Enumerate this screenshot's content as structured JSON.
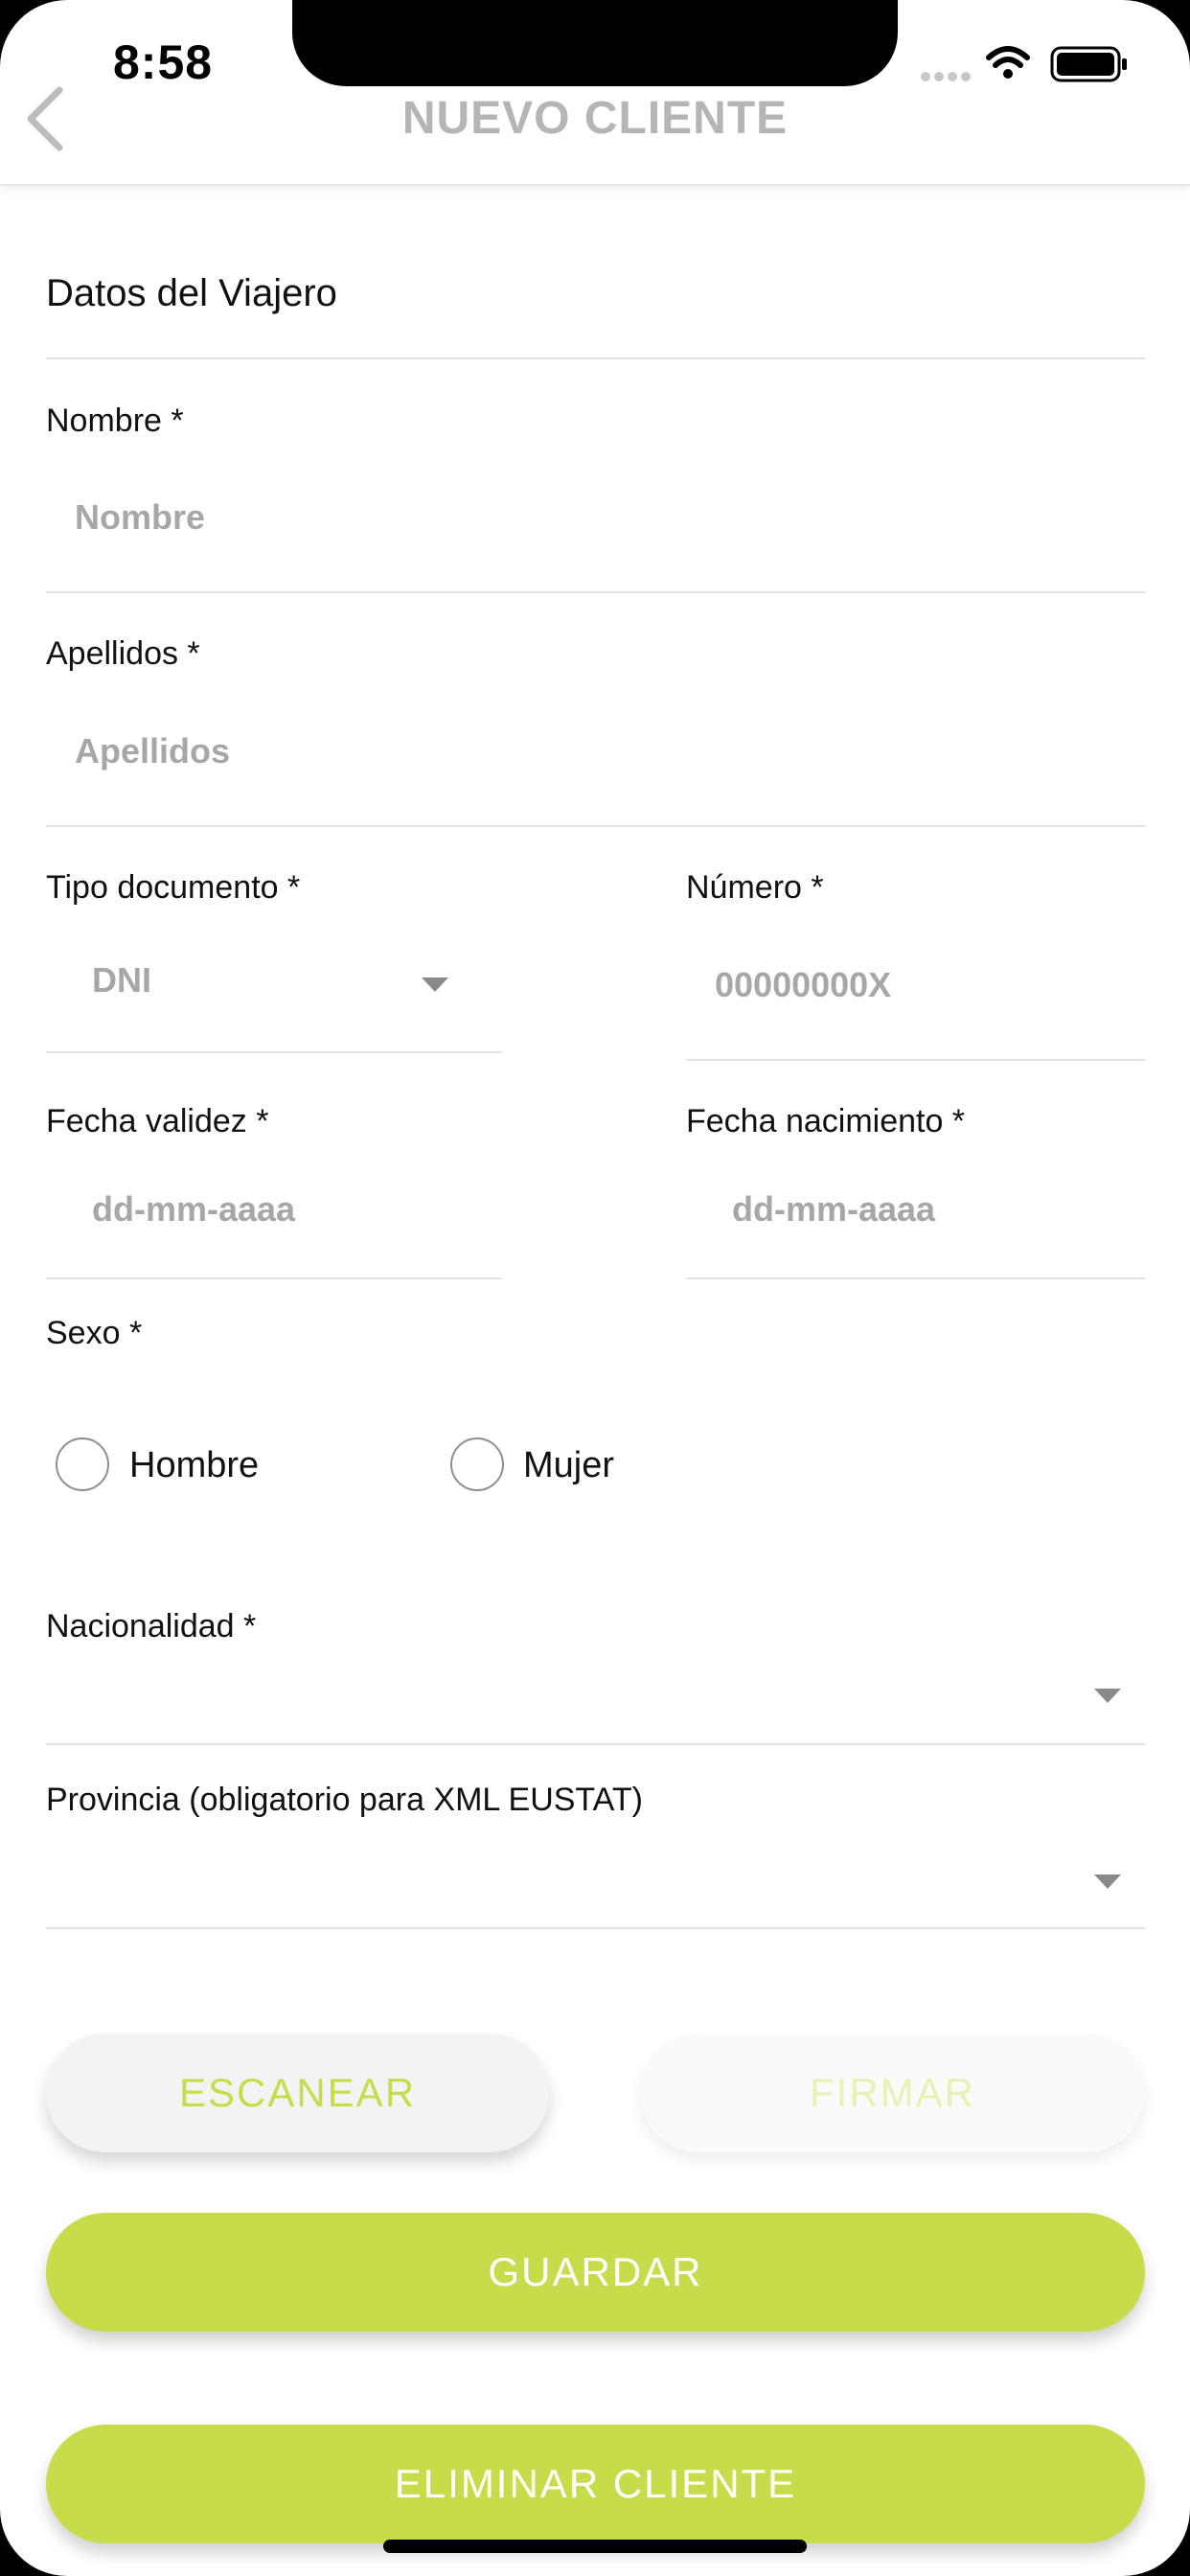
{
  "status_bar": {
    "time": "8:58"
  },
  "header": {
    "title": "NUEVO CLIENTE",
    "back_icon": "chevron-left-icon"
  },
  "form": {
    "section_title": "Datos del Viajero",
    "nombre": {
      "label": "Nombre *",
      "placeholder": "Nombre",
      "value": ""
    },
    "apellidos": {
      "label": "Apellidos *",
      "placeholder": "Apellidos",
      "value": ""
    },
    "tipo_documento": {
      "label": "Tipo documento *",
      "selected": "DNI"
    },
    "numero": {
      "label": "Número *",
      "placeholder": "00000000X",
      "value": ""
    },
    "fecha_validez": {
      "label": "Fecha validez *",
      "placeholder": "dd-mm-aaaa"
    },
    "fecha_nacimiento": {
      "label": "Fecha nacimiento *",
      "placeholder": "dd-mm-aaaa"
    },
    "sexo": {
      "label": "Sexo *",
      "options": [
        "Hombre",
        "Mujer"
      ],
      "selected": null
    },
    "nacionalidad": {
      "label": "Nacionalidad *",
      "selected": ""
    },
    "provincia": {
      "label": "Provincia (obligatorio para XML EUSTAT)",
      "selected": ""
    }
  },
  "actions": {
    "escanear": "ESCANEAR",
    "firmar": "FIRMAR",
    "guardar": "GUARDAR",
    "eliminar": "ELIMINAR CLIENTE"
  },
  "colors": {
    "accent": "#c8dc4b",
    "header_title": "#b5b5b5",
    "placeholder": "#a7a7a7"
  }
}
